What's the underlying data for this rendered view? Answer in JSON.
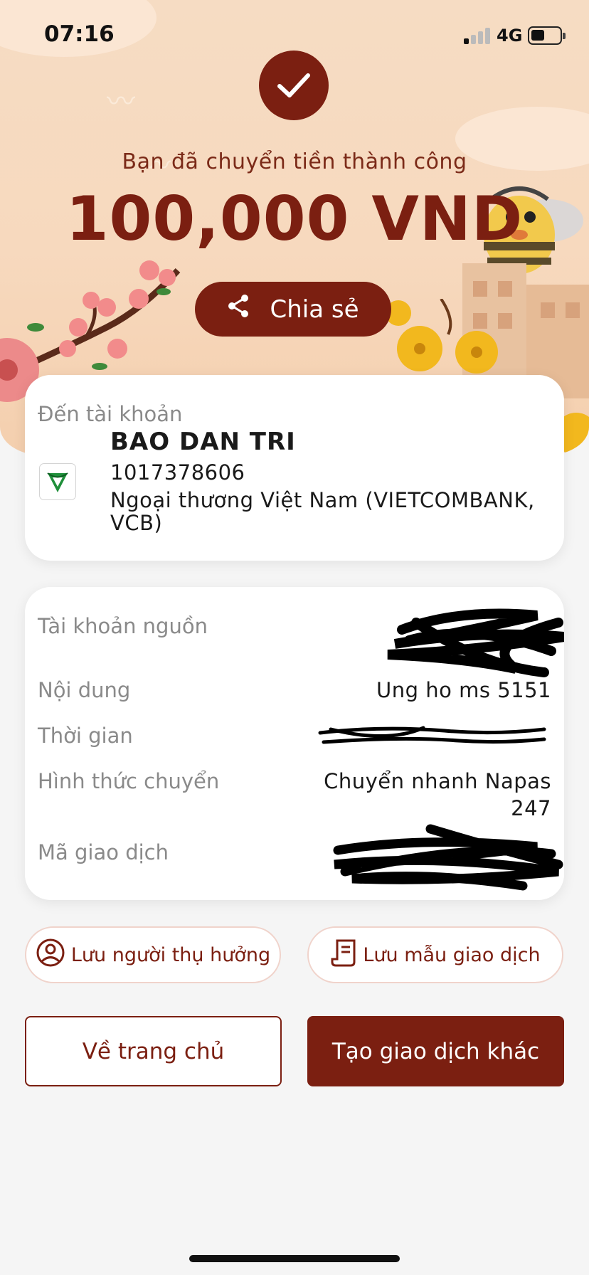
{
  "status_bar": {
    "time": "07:16",
    "network": "4G"
  },
  "result": {
    "message": "Bạn đã chuyển tiền thành công",
    "amount": "100,000 VND",
    "share_label": "Chia sẻ"
  },
  "recipient": {
    "label": "Đến tài khoản",
    "name": "BAO DAN TRI",
    "account_number": "1017378606",
    "bank_line1": "Ngoại thương Việt Nam (VIETCOMBANK,",
    "bank_line2": "VCB)"
  },
  "details": {
    "source_label": "Tài khoản nguồn",
    "content_label": "Nội dung",
    "content_value": "Ung ho ms 5151",
    "time_label": "Thời gian",
    "method_label": "Hình thức chuyển",
    "method_value_line1": "Chuyển nhanh Napas",
    "method_value_line2": "247",
    "txn_label": "Mã giao dịch"
  },
  "actions": {
    "save_beneficiary": "Lưu người thụ hưởng",
    "save_template": "Lưu mẫu giao dịch",
    "home": "Về trang chủ",
    "new_transaction": "Tạo giao dịch khác"
  },
  "colors": {
    "brand": "#7b1f11",
    "header_bg": "#f6dcc3",
    "page_bg": "#f5f5f5"
  }
}
